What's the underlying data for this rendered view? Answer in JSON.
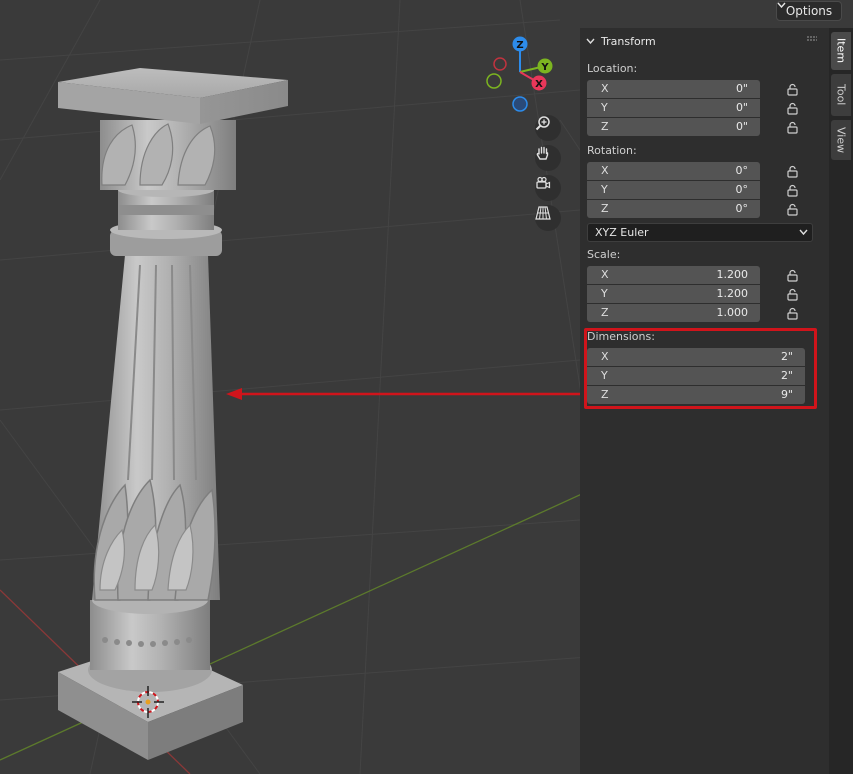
{
  "viewport": {
    "options_label": "Options",
    "gizmo_axes": {
      "z": "Z",
      "y": "Y",
      "x": "X"
    },
    "nav_icons": [
      "zoom-icon",
      "hand-pan-icon",
      "camera-icon",
      "grid-perspective-icon"
    ]
  },
  "panel": {
    "title": "Transform",
    "location": {
      "label": "Location:",
      "rows": [
        {
          "axis": "X",
          "value": "0\""
        },
        {
          "axis": "Y",
          "value": "0\""
        },
        {
          "axis": "Z",
          "value": "0\""
        }
      ]
    },
    "rotation": {
      "label": "Rotation:",
      "rows": [
        {
          "axis": "X",
          "value": "0°"
        },
        {
          "axis": "Y",
          "value": "0°"
        },
        {
          "axis": "Z",
          "value": "0°"
        }
      ],
      "mode": "XYZ Euler"
    },
    "scale": {
      "label": "Scale:",
      "rows": [
        {
          "axis": "X",
          "value": "1.200"
        },
        {
          "axis": "Y",
          "value": "1.200"
        },
        {
          "axis": "Z",
          "value": "1.000"
        }
      ]
    },
    "dimensions": {
      "label": "Dimensions:",
      "rows": [
        {
          "axis": "X",
          "value": "2\""
        },
        {
          "axis": "Y",
          "value": "2\""
        },
        {
          "axis": "Z",
          "value": "9\""
        }
      ]
    }
  },
  "tabs": [
    "Item",
    "Tool",
    "View"
  ],
  "colors": {
    "highlight": "#d0141b",
    "axis_x": "#e8375a",
    "axis_y": "#7cb520",
    "axis_z": "#2d8ceb"
  }
}
